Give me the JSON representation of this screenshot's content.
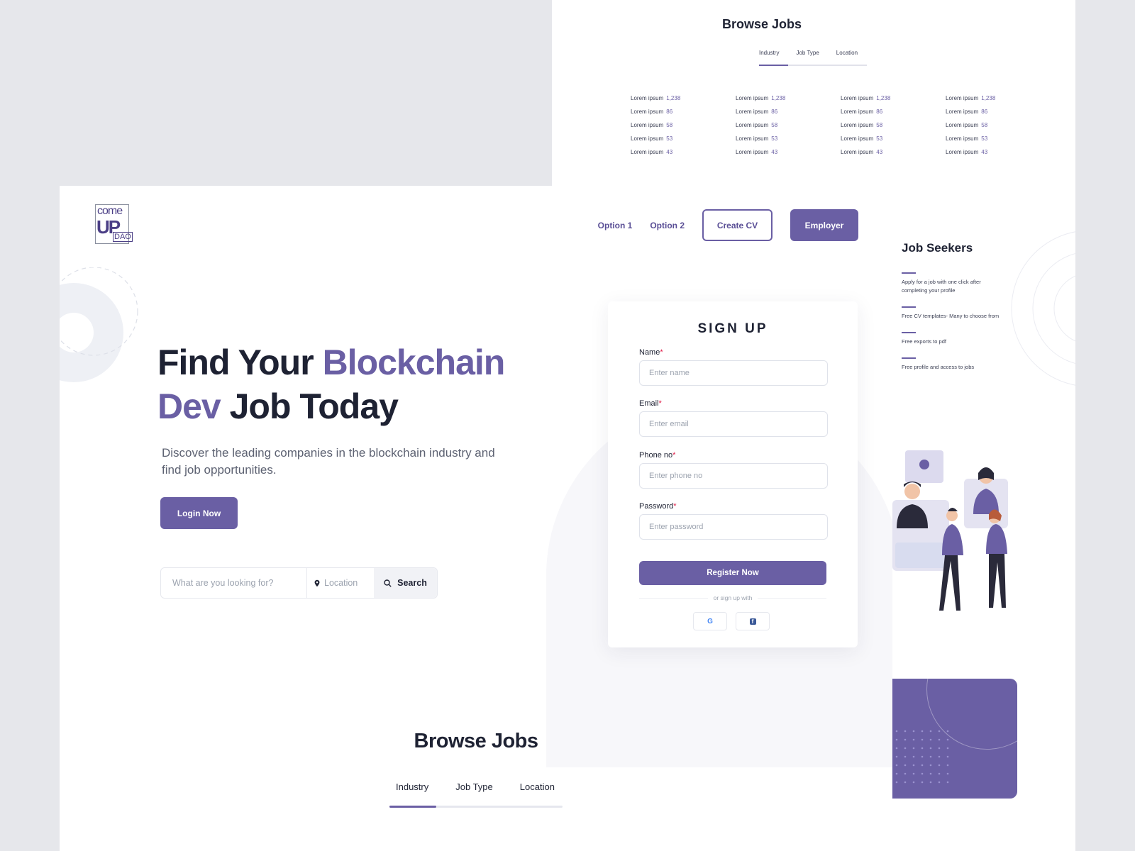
{
  "back_page": {
    "title": "Browse Jobs",
    "tabs": [
      "Industry",
      "Job Type",
      "Location"
    ],
    "columns": [
      [
        {
          "label": "Lorem ipsum",
          "count": "1,238"
        },
        {
          "label": "Lorem ipsum",
          "count": "86"
        },
        {
          "label": "Lorem ipsum",
          "count": "58"
        },
        {
          "label": "Lorem ipsum",
          "count": "53"
        },
        {
          "label": "Lorem ipsum",
          "count": "43"
        }
      ],
      [
        {
          "label": "Lorem ipsum",
          "count": "1,238"
        },
        {
          "label": "Lorem ipsum",
          "count": "86"
        },
        {
          "label": "Lorem ipsum",
          "count": "58"
        },
        {
          "label": "Lorem ipsum",
          "count": "53"
        },
        {
          "label": "Lorem ipsum",
          "count": "43"
        }
      ],
      [
        {
          "label": "Lorem ipsum",
          "count": "1,238"
        },
        {
          "label": "Lorem ipsum",
          "count": "86"
        },
        {
          "label": "Lorem ipsum",
          "count": "58"
        },
        {
          "label": "Lorem ipsum",
          "count": "53"
        },
        {
          "label": "Lorem ipsum",
          "count": "43"
        }
      ],
      [
        {
          "label": "Lorem ipsum",
          "count": "1,238"
        },
        {
          "label": "Lorem ipsum",
          "count": "86"
        },
        {
          "label": "Lorem ipsum",
          "count": "58"
        },
        {
          "label": "Lorem ipsum",
          "count": "53"
        },
        {
          "label": "Lorem ipsum",
          "count": "43"
        }
      ]
    ],
    "job_seekers": {
      "title": "Job Seekers",
      "items": [
        "Apply for a job with one click after completing your profile",
        "Free CV templates- Many to choose from",
        "Free exports to pdf",
        "Free profile and access to jobs"
      ]
    }
  },
  "logo": {
    "line1": "come",
    "line2": "UP",
    "line3": "DAO"
  },
  "nav": {
    "option1": "Option 1",
    "option2": "Option 2",
    "create_cv": "Create CV",
    "employer": "Employer"
  },
  "hero": {
    "title_part1": "Find Your ",
    "title_accent1": "Blockchain",
    "title_accent2": "Dev",
    "title_part2": " Job Today",
    "subtitle": "Discover the leading companies in the blockchain industry and find job opportunities.",
    "login_label": "Login Now"
  },
  "search": {
    "query_placeholder": "What are you looking for?",
    "location_placeholder": "Location",
    "button_label": "Search"
  },
  "signup": {
    "title": "SIGN UP",
    "fields": [
      {
        "label": "Name",
        "placeholder": "Enter name"
      },
      {
        "label": "Email",
        "placeholder": "Enter email"
      },
      {
        "label": "Phone no",
        "placeholder": "Enter phone no"
      },
      {
        "label": "Password",
        "placeholder": "Enter password"
      }
    ],
    "required_mark": "*",
    "register_label": "Register Now",
    "or_text": "or sign up with",
    "social": [
      {
        "icon": "google-icon",
        "glyph": "G"
      },
      {
        "icon": "facebook-icon",
        "glyph": "f"
      }
    ]
  },
  "browse": {
    "title": "Browse Jobs",
    "tabs": [
      "Industry",
      "Job Type",
      "Location"
    ]
  },
  "colors": {
    "accent": "#6a5fa4",
    "dark": "#1e2233",
    "page_bg": "#e6e7eb"
  }
}
